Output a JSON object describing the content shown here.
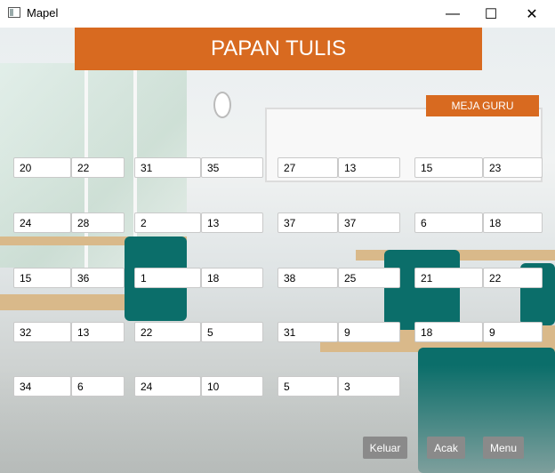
{
  "window": {
    "title": "Mapel"
  },
  "board_label": "PAPAN TULIS",
  "teacher_desk_label": "MEJA GURU",
  "seat_rows": [
    [
      "20",
      "22",
      "31",
      "35",
      "27",
      "13",
      "15",
      "23"
    ],
    [
      "24",
      "28",
      "2",
      "13",
      "37",
      "37",
      "6",
      "18"
    ],
    [
      "15",
      "36",
      "1",
      "18",
      "38",
      "25",
      "21",
      "22"
    ],
    [
      "32",
      "13",
      "22",
      "5",
      "31",
      "9",
      "18",
      "9"
    ],
    [
      "34",
      "6",
      "24",
      "10",
      "5",
      "3"
    ]
  ],
  "buttons": {
    "exit": "Keluar",
    "shuffle": "Acak",
    "menu": "Menu"
  },
  "colors": {
    "accent": "#d86a20",
    "button": "#8a8a8a"
  }
}
